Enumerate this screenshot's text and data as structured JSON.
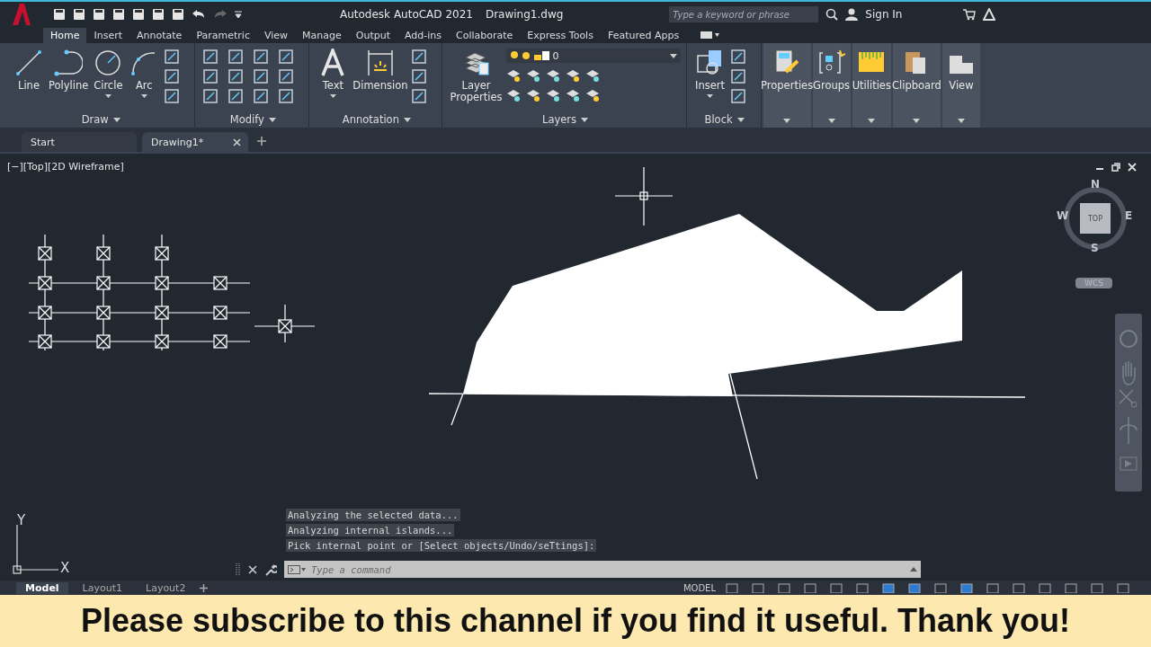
{
  "title_bar": {
    "app_title": "Autodesk AutoCAD 2021",
    "file_name": "Drawing1.dwg",
    "search": {
      "placeholder": "Type a keyword or phrase"
    },
    "sign_in": "Sign In"
  },
  "ribbon_tabs": [
    {
      "label": "Home",
      "selected": true
    },
    {
      "label": "Insert",
      "selected": false
    },
    {
      "label": "Annotate",
      "selected": false
    },
    {
      "label": "Parametric",
      "selected": false
    },
    {
      "label": "View",
      "selected": false
    },
    {
      "label": "Manage",
      "selected": false
    },
    {
      "label": "Output",
      "selected": false
    },
    {
      "label": "Add-ins",
      "selected": false
    },
    {
      "label": "Collaborate",
      "selected": false
    },
    {
      "label": "Express Tools",
      "selected": false
    },
    {
      "label": "Featured Apps",
      "selected": false
    }
  ],
  "ribbon_panels": [
    {
      "title": "Draw",
      "tools": [
        {
          "label": "Line",
          "has_menu": false
        },
        {
          "label": "Polyline",
          "has_menu": false
        },
        {
          "label": "Circle",
          "has_menu": true
        },
        {
          "label": "Arc",
          "has_menu": true
        }
      ]
    },
    {
      "title": "Modify"
    },
    {
      "title": "Annotation",
      "tools": [
        {
          "label": "Text",
          "has_menu": true
        },
        {
          "label": "Dimension",
          "has_menu": false
        }
      ]
    },
    {
      "title": "Layers",
      "tools": [
        {
          "label": "Layer Properties",
          "has_menu": false
        }
      ],
      "layer": "0"
    },
    {
      "title": "Block",
      "tools": [
        {
          "label": "Insert",
          "has_menu": true
        }
      ]
    }
  ],
  "collapsed_panels": [
    {
      "label": "Properties"
    },
    {
      "label": "Groups"
    },
    {
      "label": "Utilities"
    },
    {
      "label": "Clipboard"
    },
    {
      "label": "View"
    }
  ],
  "file_tabs": [
    {
      "label": "Start",
      "selected": false,
      "closable": false
    },
    {
      "label": "Drawing1*",
      "selected": true,
      "closable": true
    }
  ],
  "viewport": {
    "label": "[−][Top][2D Wireframe]",
    "viewcube": {
      "north": "N",
      "south": "S",
      "east": "E",
      "west": "W",
      "face": "TOP"
    },
    "ucs_menu": "WCS",
    "ucs_axes": {
      "x": "X",
      "y": "Y"
    }
  },
  "command_history": [
    "Analyzing the selected data...",
    "Analyzing internal islands...",
    "Pick internal point or [Select objects/Undo/seTtings]:"
  ],
  "command_line": {
    "placeholder": "Type a command"
  },
  "layout_tabs": [
    {
      "label": "Model",
      "selected": true
    },
    {
      "label": "Layout1",
      "selected": false
    },
    {
      "label": "Layout2",
      "selected": false
    }
  ],
  "status_bar": {
    "space": "MODEL"
  },
  "banner": {
    "text": "Please **subscribe** to this channel if you find it useful. Thank you!"
  }
}
